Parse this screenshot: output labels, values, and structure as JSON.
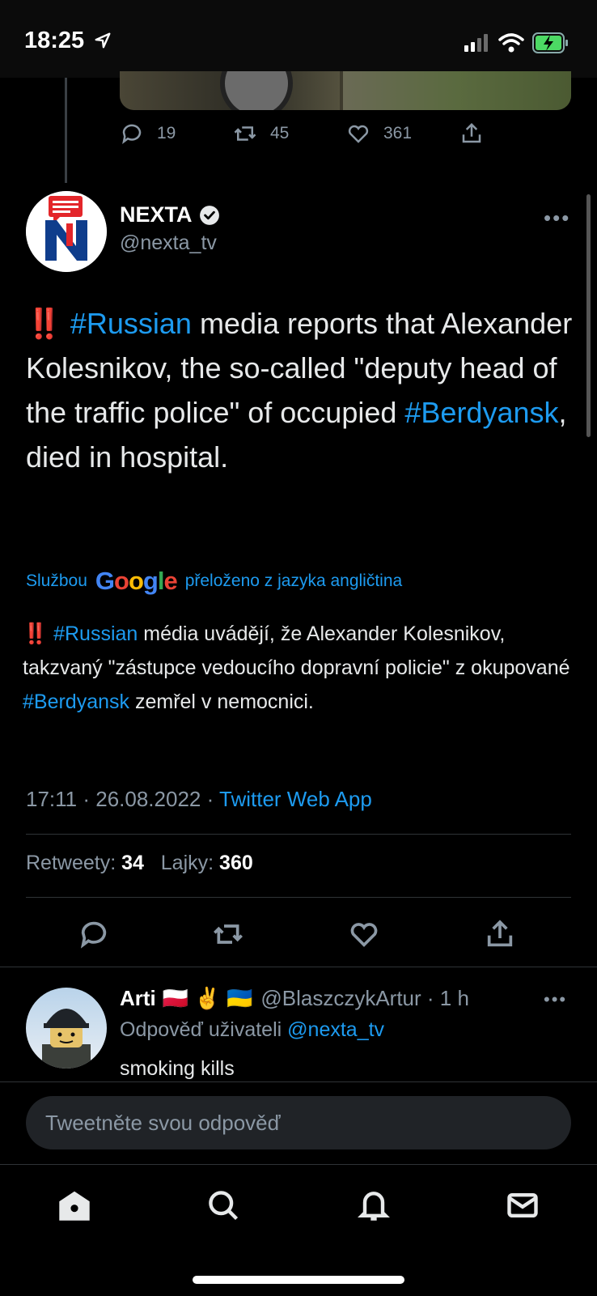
{
  "status_bar": {
    "time": "18:25"
  },
  "previous_tweet": {
    "replies": "19",
    "retweets": "45",
    "likes": "361"
  },
  "tweet": {
    "author_name": "NEXTA",
    "author_handle": "@nexta_tv",
    "text_parts": {
      "bang": "‼️",
      "hashtag1": "#Russian",
      "part1": " media reports that Alexander Kolesnikov, the so-called \"deputy head of the traffic police\" of occupied ",
      "hashtag2": "#Berdyansk",
      "part2": ", died in hospital."
    },
    "translation": {
      "prefix": "Službou",
      "brand": "Google",
      "suffix": "přeloženo z jazyka angličtina",
      "bang": "‼️",
      "hashtag1": "#Russian",
      "part1": " média uvádějí, že Alexander Kolesnikov, takzvaný \"zástupce vedoucího dopravní policie\" z okupované ",
      "hashtag2": "#Berdyansk",
      "part2": " zemřel v nemocnici."
    },
    "timestamp": "17:11 · 26.08.2022 · ",
    "source": "Twitter Web App",
    "retweets_label": "Retweety:",
    "retweets_count": "34",
    "likes_label": "Lajky:",
    "likes_count": "360"
  },
  "reply": {
    "author_name": "Arti",
    "flags": "🇵🇱 ✌️ 🇺🇦",
    "handle_time": "@BlaszczykArtur · 1 h",
    "replying_prefix": "Odpověď uživateli ",
    "replying_handle": "@nexta_tv",
    "text": "smoking kills"
  },
  "compose": {
    "placeholder": "Tweetněte svou odpověď"
  },
  "colors": {
    "accent": "#1d9bf0",
    "background": "#000000",
    "muted": "#8b98a5"
  },
  "icons": [
    "location-arrow-icon",
    "signal-icon",
    "wifi-icon",
    "battery-charging-icon",
    "verified-badge-icon",
    "reply-icon",
    "retweet-icon",
    "like-icon",
    "share-icon",
    "more-icon",
    "home-icon",
    "search-icon",
    "notifications-icon",
    "messages-icon"
  ]
}
